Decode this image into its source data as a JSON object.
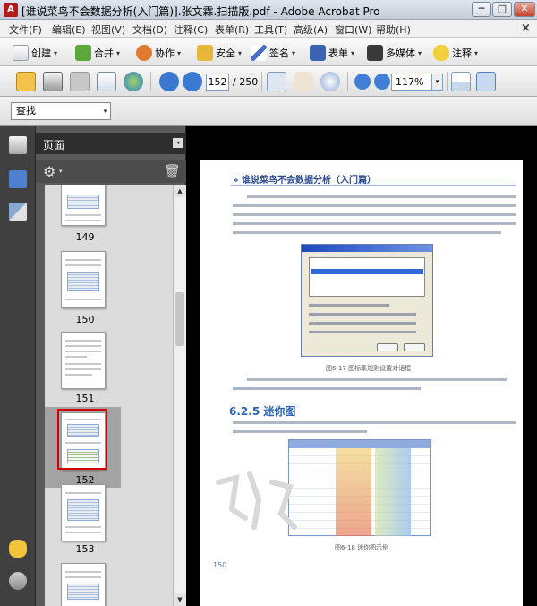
{
  "window": {
    "title": "[谁说菜鸟不会数据分析(入门篇)].张文霖.扫描版.pdf - Adobe Acrobat Pro",
    "min_label": "─",
    "max_label": "□",
    "close_label": "✕"
  },
  "menu": {
    "items": [
      "文件(F)",
      "编辑(E)",
      "视图(V)",
      "文档(D)",
      "注释(C)",
      "表单(R)",
      "工具(T)",
      "高级(A)",
      "窗口(W)",
      "帮助(H)"
    ],
    "close_label": "×"
  },
  "tasks": {
    "create": "创建",
    "combine": "合并",
    "collaborate": "协作",
    "secure": "安全",
    "sign": "签名",
    "forms": "表单",
    "multimedia": "多媒体",
    "comment": "注释",
    "dropdown_glyph": "▾"
  },
  "navigation": {
    "current_page": "152",
    "total_pages": "/ 250",
    "zoom": "117%",
    "dropdown_glyph": "▾"
  },
  "find": {
    "value": "查找",
    "dropdown_glyph": "▾"
  },
  "pages_panel": {
    "title": "页面",
    "collapse_glyph": "◂",
    "gear_glyph": "⚙",
    "gear_arrow": "▾",
    "trash_glyph": "🗑",
    "thumbnails": [
      {
        "label": "149"
      },
      {
        "label": "150"
      },
      {
        "label": "151"
      },
      {
        "label": "152",
        "selected": true
      },
      {
        "label": "153"
      }
    ],
    "scroll_up": "▲",
    "scroll_down": "▼"
  },
  "document": {
    "running_header": "» 谁说菜鸟不会数据分析（入门篇）",
    "figure1_caption": "图6-17  图标集规则设置对话框",
    "section_title": "6.2.5   迷你图",
    "figure2_caption": "图6-18  迷你图示例",
    "page_number": "150"
  },
  "colors": {
    "accent_blue": "#2b63b5",
    "selection_red": "#d40000",
    "panel_dark": "#404040"
  }
}
